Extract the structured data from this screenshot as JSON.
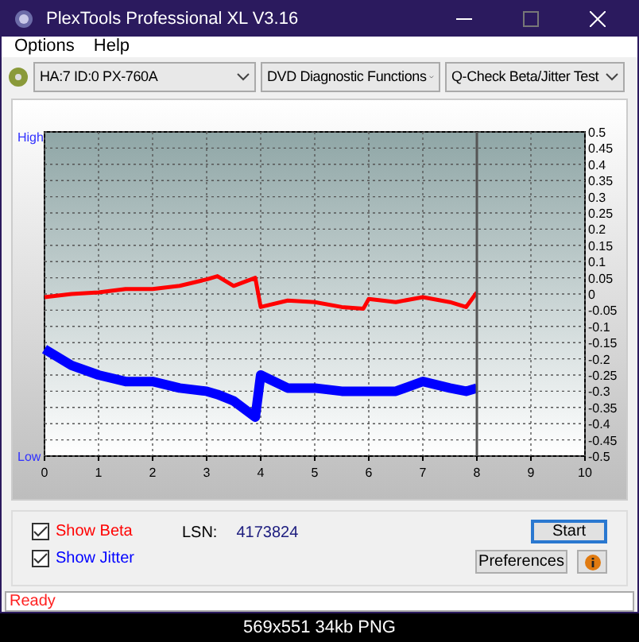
{
  "window": {
    "title": "PlexTools Professional XL V3.16"
  },
  "menu": [
    "Options",
    "Help"
  ],
  "toolbar": {
    "drive": "HA:7 ID:0  PX-760A",
    "function": "DVD Diagnostic Functions",
    "test": "Q-Check Beta/Jitter Test"
  },
  "chart": {
    "high_label": "High",
    "low_label": "Low",
    "chart_data": {
      "type": "line",
      "grid": true,
      "ref_lines": [
        {
          "axis": "x",
          "value": 8,
          "color": "#555555"
        }
      ],
      "x": [
        0,
        0.5,
        1,
        1.5,
        2,
        2.5,
        3,
        3.2,
        3.5,
        3.9,
        4.0,
        4.5,
        5,
        5.5,
        5.9,
        6,
        6.5,
        7,
        7.5,
        7.8,
        8
      ],
      "series": [
        {
          "color": "#ff0000",
          "values": [
            -0.01,
            0,
            0.005,
            0.015,
            0.015,
            0.025,
            0.045,
            0.055,
            0.025,
            0.05,
            -0.04,
            -0.02,
            -0.025,
            -0.04,
            -0.045,
            -0.015,
            -0.025,
            -0.01,
            -0.025,
            -0.04,
            0.005
          ]
        },
        {
          "color": "#0000ff",
          "values": [
            -0.17,
            -0.22,
            -0.25,
            -0.27,
            -0.27,
            -0.29,
            -0.3,
            -0.31,
            -0.33,
            -0.38,
            -0.25,
            -0.29,
            -0.29,
            -0.3,
            -0.3,
            -0.3,
            -0.3,
            -0.27,
            -0.29,
            -0.3,
            -0.29
          ]
        }
      ],
      "xlim": [
        0,
        10
      ],
      "ylim": [
        -0.5,
        0.5
      ],
      "xticks": [
        0,
        1,
        2,
        3,
        4,
        5,
        6,
        7,
        8,
        9,
        10
      ],
      "yticks": [
        {
          "value": 0.5,
          "label": "0.5"
        },
        {
          "value": 0.45,
          "label": "0.45"
        },
        {
          "value": 0.4,
          "label": "0.4"
        },
        {
          "value": 0.35,
          "label": "0.35"
        },
        {
          "value": 0.3,
          "label": "0.3"
        },
        {
          "value": 0.25,
          "label": "0.25"
        },
        {
          "value": 0.2,
          "label": "0.2"
        },
        {
          "value": 0.15,
          "label": "0.15"
        },
        {
          "value": 0.1,
          "label": "0.1"
        },
        {
          "value": 0.05,
          "label": "0.05"
        },
        {
          "value": 0,
          "label": "0"
        },
        {
          "value": -0.05,
          "label": "-0.05"
        },
        {
          "value": -0.1,
          "label": "-0.1"
        },
        {
          "value": -0.15,
          "label": "-0.15"
        },
        {
          "value": -0.2,
          "label": "-0.2"
        },
        {
          "value": -0.25,
          "label": "-0.25"
        },
        {
          "value": -0.3,
          "label": "-0.3"
        },
        {
          "value": -0.35,
          "label": "-0.35"
        },
        {
          "value": -0.4,
          "label": "-0.4"
        },
        {
          "value": -0.45,
          "label": "-0.45"
        },
        {
          "value": -0.5,
          "label": "-0.5"
        }
      ]
    }
  },
  "controls": {
    "checkboxes": [
      {
        "label": "Show Beta",
        "checked": true,
        "color": "#ff0000"
      },
      {
        "label": "Show Jitter",
        "checked": true,
        "color": "#0000ff"
      }
    ],
    "lsn_label": "LSN:",
    "lsn_value": "4173824",
    "start": "Start",
    "preferences": "Preferences"
  },
  "status_bar": "Ready",
  "caption": "569x551 34kb PNG"
}
